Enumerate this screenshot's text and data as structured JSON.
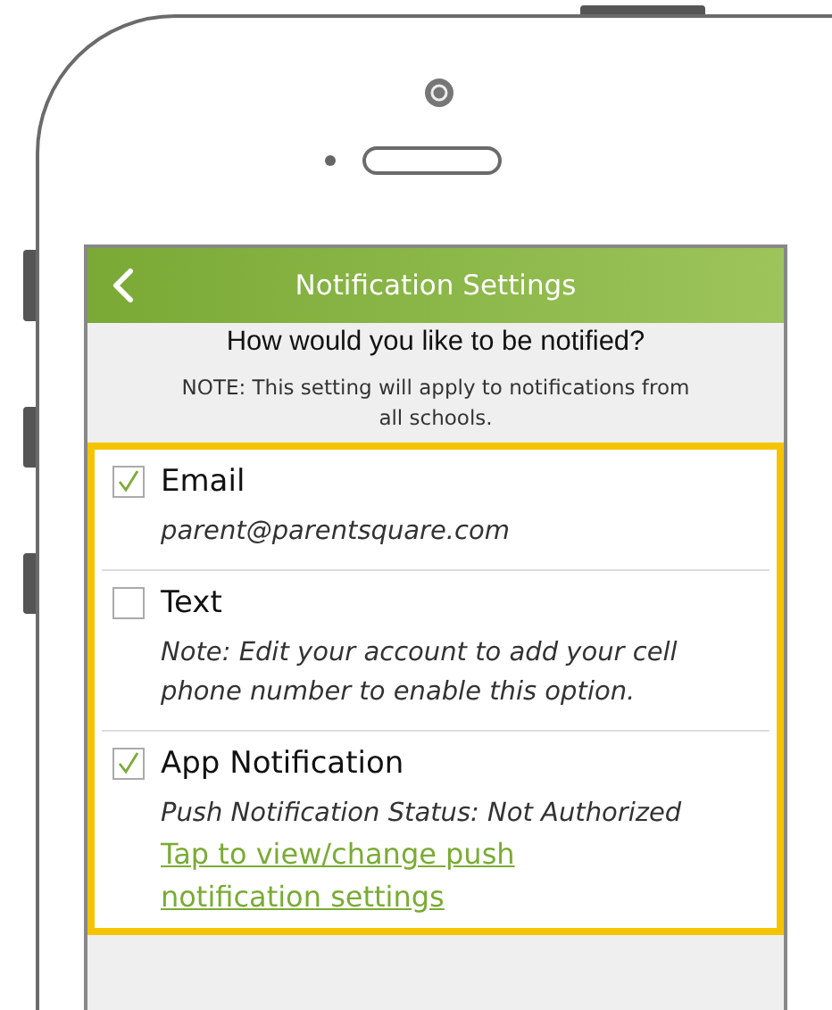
{
  "header": {
    "title": "Notification Settings"
  },
  "prompt": "How would you like to be notified?",
  "note": "NOTE: This setting will apply to notifications from all schools.",
  "options": [
    {
      "label": "Email",
      "checked": true,
      "details": [
        {
          "kind": "text",
          "text": "parent@parentsquare.com"
        }
      ]
    },
    {
      "label": "Text",
      "checked": false,
      "details": [
        {
          "kind": "text",
          "text": "Note: Edit your account to add your cell phone number to enable this option."
        }
      ]
    },
    {
      "label": "App Notification",
      "checked": true,
      "details": [
        {
          "kind": "text",
          "text": "Push Notification Status: Not Authorized"
        },
        {
          "kind": "link",
          "text": "Tap to view/change push notification settings"
        }
      ]
    }
  ]
}
